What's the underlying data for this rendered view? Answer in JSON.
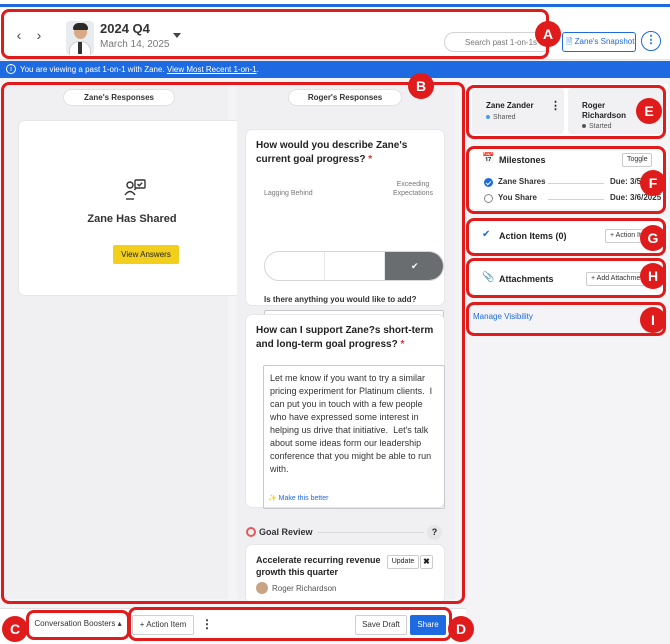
{
  "header": {
    "period": "2024 Q4",
    "date": "March 14, 2025",
    "search_placeholder": "Search past 1-on-1s",
    "snapshot_label": "Zane's Snapshot",
    "kebab": "⋮"
  },
  "banner": {
    "text": "You are viewing a past 1-on-1 with Zane.",
    "link": "View Most Recent 1-on-1",
    "suffix": "."
  },
  "left": {
    "tab_label": "Zane's Responses",
    "shared_title": "Zane Has Shared",
    "view_button": "View Answers"
  },
  "mid": {
    "tab_label": "Roger's Responses",
    "q1": {
      "title": "How would you describe Zane's current goal progress?",
      "required": "*",
      "low_label": "Lagging Behind",
      "high_label": "Exceeding Expectations",
      "selected_index": 2,
      "add_label": "Is there anything you would like to add?"
    },
    "q2": {
      "title": "How can I support Zane?s short-term and long-term goal progress?",
      "required": "*",
      "answer": "Let me know if you want to try a similar pricing experiment for Platinum clients.  I can put you in touch with a few people who have expressed some interest in helping us drive that initiative.  Let's talk about some ideas form our leadership conference that you might be able to run with.",
      "make_better": "Make this better"
    },
    "goal_review": {
      "label": "Goal Review",
      "help": "?",
      "goal_title": "Accelerate recurring revenue growth this quarter",
      "update_label": "Update",
      "close_label": "✖",
      "owner": "Roger Richardson"
    }
  },
  "right": {
    "participants": [
      {
        "name": "Zane Zander",
        "status": "Shared",
        "status_color": "#4a9be8"
      },
      {
        "name": "Roger Richardson",
        "status": "Started",
        "status_color": "#555555"
      }
    ],
    "milestones": {
      "title": "Milestones",
      "toggle_label": "Toggle",
      "items": [
        {
          "name": "Zane Shares",
          "due": "Due: 3/5/2025",
          "done": true
        },
        {
          "name": "You Share",
          "due": "Due: 3/6/2025",
          "done": false
        }
      ]
    },
    "action_items": {
      "title": "Action Items (0)",
      "button": "+ Action Item"
    },
    "attachments": {
      "title": "Attachments",
      "button": "+ Add Attachment"
    },
    "manage_visibility": "Manage Visibility"
  },
  "bottom": {
    "boosters_label": "Conversation Boosters",
    "action_item_label": "+ Action Item",
    "more": "⋮",
    "save_draft": "Save Draft",
    "share": "Share"
  },
  "callouts": [
    "A",
    "B",
    "C",
    "D",
    "E",
    "F",
    "G",
    "H",
    "I"
  ],
  "colors": {
    "accent": "#1e6ae0",
    "callout": "#e01b1b",
    "view_answers": "#f2cf1c"
  }
}
